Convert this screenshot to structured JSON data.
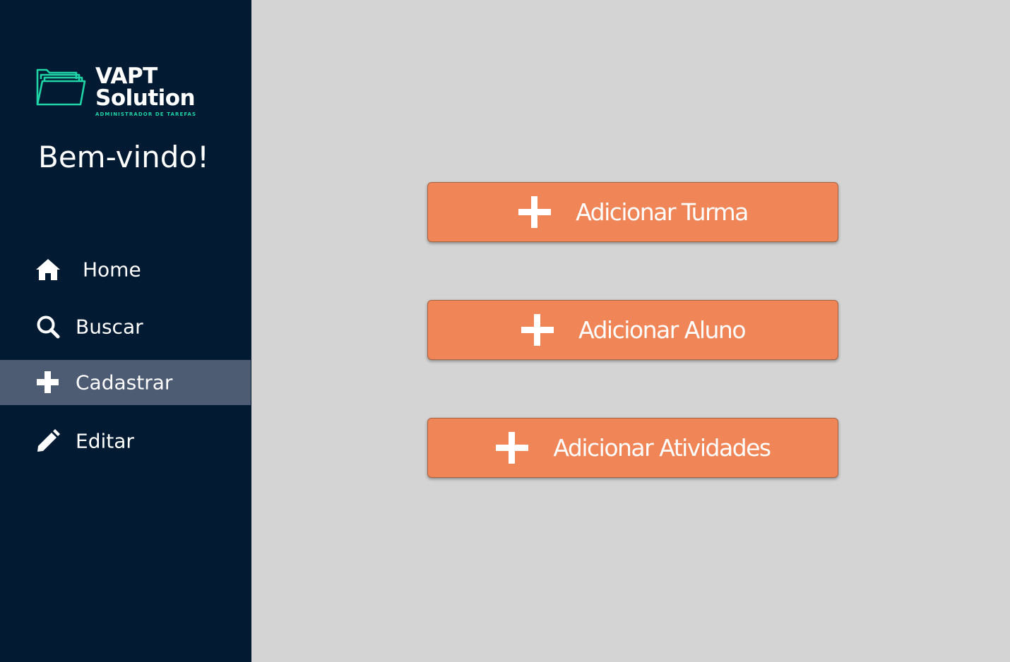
{
  "brand": {
    "name_line1": "VAPT",
    "name_line2": "Solution",
    "tagline": "ADMINISTRADOR DE TAREFAS",
    "icon": "folder-icon",
    "accent_color": "#1fd4a6"
  },
  "sidebar": {
    "welcome": "Bem-vindo!",
    "background": "#021b33",
    "active_background": "#4d5b73",
    "items": [
      {
        "label": "Home",
        "icon": "home-icon",
        "active": false
      },
      {
        "label": "Buscar",
        "icon": "search-icon",
        "active": false
      },
      {
        "label": "Cadastrar",
        "icon": "plus-icon",
        "active": true
      },
      {
        "label": "Editar",
        "icon": "pencil-icon",
        "active": false
      }
    ]
  },
  "main": {
    "background": "#d4d4d4",
    "button_color": "#f08658",
    "actions": [
      {
        "label": "Adicionar Turma",
        "icon": "plus-icon"
      },
      {
        "label": "Adicionar Aluno",
        "icon": "plus-icon"
      },
      {
        "label": "Adicionar Atividades",
        "icon": "plus-icon"
      }
    ]
  }
}
